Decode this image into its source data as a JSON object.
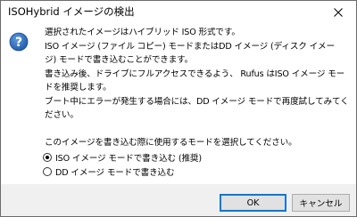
{
  "window": {
    "title": "ISOHybrid イメージの検出"
  },
  "message": {
    "lines": [
      "選択されたイメージはハイブリッド ISO 形式です。",
      "ISO イメージ (ファイル コピー) モードまたはDD イメージ (ディスク イメー",
      "ジ) モードで書き込むことができます。",
      "書き込み後、ドライブにフルアクセスできるよう、 Rufus はISO イメージ モー",
      "ドを推奨します。",
      "ブート中にエラーが発生する場合には、DD イメージ モードで再度試してみてく",
      "ださい。"
    ],
    "prompt": "このイメージを書き込む際に使用するモードを選択してください。"
  },
  "options": [
    {
      "label": "ISO イメージ モードで書き込む (推奨)",
      "checked": true
    },
    {
      "label": "DD イメージ モードで書き込む",
      "checked": false
    }
  ],
  "buttons": {
    "ok": "OK",
    "cancel": "キャンセル"
  },
  "icons": {
    "dialog": "question-icon",
    "close": "close-icon"
  },
  "colors": {
    "accent": "#0078d7",
    "footer_bg": "#f0f0f0",
    "icon_blue": "#2a67b8"
  }
}
